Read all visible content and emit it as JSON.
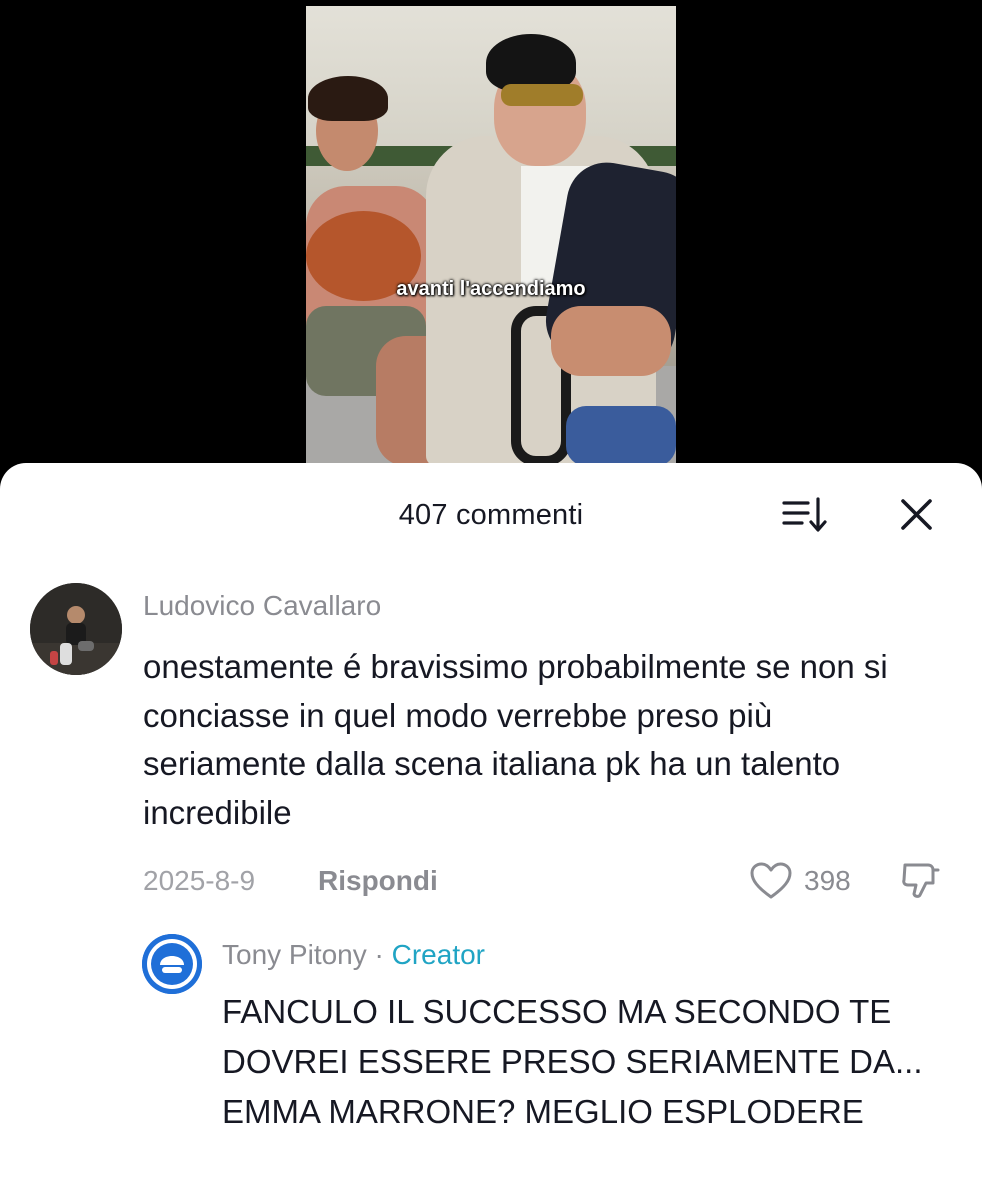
{
  "video": {
    "caption": "avanti l'accendiamo"
  },
  "comments_panel": {
    "title": "407 commenti",
    "sort_icon": "sort-list-icon",
    "close_icon": "close-icon"
  },
  "comment": {
    "author": "Ludovico Cavallaro",
    "text": "onestamente é bravissimo probabilmente se non si conciasse in quel modo verrebbe preso più seriamente dalla scena italiana pk ha un talento incredibile",
    "date": "2025-8-9",
    "reply_label": "Rispondi",
    "likes": "398",
    "like_icon": "heart-outline-icon",
    "dislike_icon": "thumbs-down-icon"
  },
  "reply": {
    "author": "Tony Pitony",
    "separator": "·",
    "badge": "Creator",
    "text": "FANCULO IL SUCCESSO MA SECONDO TE DOVREI ESSERE PRESO SERIAMENTE DA... EMMA MARRONE? MEGLIO ESPLODERE"
  },
  "colors": {
    "text_primary": "#161823",
    "text_secondary": "#8a8b91",
    "creator": "#20a4c4",
    "sheet_bg": "#ffffff"
  }
}
